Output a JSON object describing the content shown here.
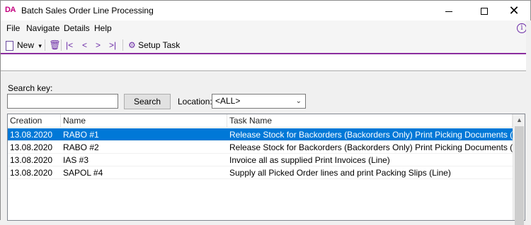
{
  "window": {
    "app_icon": "DA",
    "title": "Batch Sales Order Line Processing",
    "minimize_glyph": "",
    "close_glyph": "✕"
  },
  "menu": {
    "file": "File",
    "navigate": "Navigate",
    "details": "Details",
    "help": "Help",
    "info_glyph": "i"
  },
  "toolbar": {
    "new_label": "New",
    "new_dropdown_glyph": "▾",
    "delete_glyph": "🗑",
    "first_glyph": "|<",
    "prev_glyph": "<",
    "next_glyph": ">",
    "last_glyph": ">|",
    "setup_task_label": "Setup Task",
    "setup_icon_glyph": "⚙"
  },
  "search": {
    "label": "Search key:",
    "value": "",
    "button_label": "Search",
    "location_label": "Location:",
    "location_value": "<ALL>"
  },
  "grid": {
    "columns": [
      "Creation Date",
      "Name",
      "Task Name"
    ],
    "rows": [
      {
        "date": "13.08.2020",
        "name": "RABO #1",
        "task": "Release Stock for Backorders (Backorders Only) Print Picking Documents (Line)",
        "selected": true
      },
      {
        "date": "13.08.2020",
        "name": "RABO #2",
        "task": "Release Stock for Backorders (Backorders Only) Print Picking Documents (Line)",
        "selected": false
      },
      {
        "date": "13.08.2020",
        "name": "IAS #3",
        "task": "Invoice all as supplied Print Invoices (Line)",
        "selected": false
      },
      {
        "date": "13.08.2020",
        "name": "SAPOL #4",
        "task": "Supply all Picked Order lines and print Packing Slips (Line)",
        "selected": false
      }
    ]
  },
  "colors": {
    "accent": "#8a2d9e",
    "selection": "#0078d7",
    "brand_icon": "#c3007e"
  }
}
